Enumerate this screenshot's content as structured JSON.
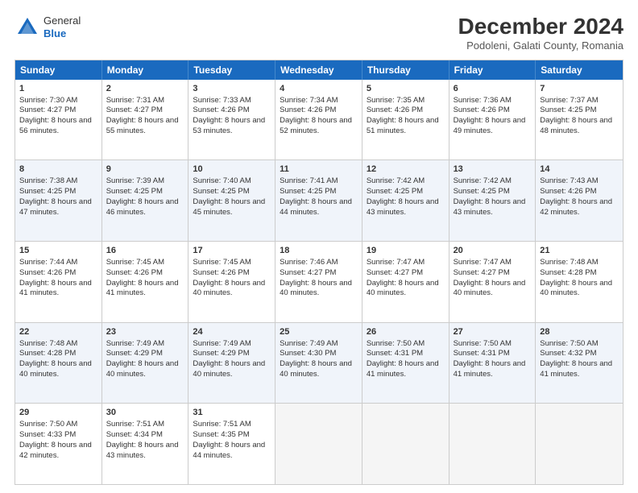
{
  "header": {
    "logo_general": "General",
    "logo_blue": "Blue",
    "title": "December 2024",
    "subtitle": "Podoleni, Galati County, Romania"
  },
  "days": [
    "Sunday",
    "Monday",
    "Tuesday",
    "Wednesday",
    "Thursday",
    "Friday",
    "Saturday"
  ],
  "weeks": [
    [
      {
        "num": "1",
        "sunrise": "Sunrise: 7:30 AM",
        "sunset": "Sunset: 4:27 PM",
        "daylight": "Daylight: 8 hours and 56 minutes."
      },
      {
        "num": "2",
        "sunrise": "Sunrise: 7:31 AM",
        "sunset": "Sunset: 4:27 PM",
        "daylight": "Daylight: 8 hours and 55 minutes."
      },
      {
        "num": "3",
        "sunrise": "Sunrise: 7:33 AM",
        "sunset": "Sunset: 4:26 PM",
        "daylight": "Daylight: 8 hours and 53 minutes."
      },
      {
        "num": "4",
        "sunrise": "Sunrise: 7:34 AM",
        "sunset": "Sunset: 4:26 PM",
        "daylight": "Daylight: 8 hours and 52 minutes."
      },
      {
        "num": "5",
        "sunrise": "Sunrise: 7:35 AM",
        "sunset": "Sunset: 4:26 PM",
        "daylight": "Daylight: 8 hours and 51 minutes."
      },
      {
        "num": "6",
        "sunrise": "Sunrise: 7:36 AM",
        "sunset": "Sunset: 4:26 PM",
        "daylight": "Daylight: 8 hours and 49 minutes."
      },
      {
        "num": "7",
        "sunrise": "Sunrise: 7:37 AM",
        "sunset": "Sunset: 4:25 PM",
        "daylight": "Daylight: 8 hours and 48 minutes."
      }
    ],
    [
      {
        "num": "8",
        "sunrise": "Sunrise: 7:38 AM",
        "sunset": "Sunset: 4:25 PM",
        "daylight": "Daylight: 8 hours and 47 minutes."
      },
      {
        "num": "9",
        "sunrise": "Sunrise: 7:39 AM",
        "sunset": "Sunset: 4:25 PM",
        "daylight": "Daylight: 8 hours and 46 minutes."
      },
      {
        "num": "10",
        "sunrise": "Sunrise: 7:40 AM",
        "sunset": "Sunset: 4:25 PM",
        "daylight": "Daylight: 8 hours and 45 minutes."
      },
      {
        "num": "11",
        "sunrise": "Sunrise: 7:41 AM",
        "sunset": "Sunset: 4:25 PM",
        "daylight": "Daylight: 8 hours and 44 minutes."
      },
      {
        "num": "12",
        "sunrise": "Sunrise: 7:42 AM",
        "sunset": "Sunset: 4:25 PM",
        "daylight": "Daylight: 8 hours and 43 minutes."
      },
      {
        "num": "13",
        "sunrise": "Sunrise: 7:42 AM",
        "sunset": "Sunset: 4:25 PM",
        "daylight": "Daylight: 8 hours and 43 minutes."
      },
      {
        "num": "14",
        "sunrise": "Sunrise: 7:43 AM",
        "sunset": "Sunset: 4:26 PM",
        "daylight": "Daylight: 8 hours and 42 minutes."
      }
    ],
    [
      {
        "num": "15",
        "sunrise": "Sunrise: 7:44 AM",
        "sunset": "Sunset: 4:26 PM",
        "daylight": "Daylight: 8 hours and 41 minutes."
      },
      {
        "num": "16",
        "sunrise": "Sunrise: 7:45 AM",
        "sunset": "Sunset: 4:26 PM",
        "daylight": "Daylight: 8 hours and 41 minutes."
      },
      {
        "num": "17",
        "sunrise": "Sunrise: 7:45 AM",
        "sunset": "Sunset: 4:26 PM",
        "daylight": "Daylight: 8 hours and 40 minutes."
      },
      {
        "num": "18",
        "sunrise": "Sunrise: 7:46 AM",
        "sunset": "Sunset: 4:27 PM",
        "daylight": "Daylight: 8 hours and 40 minutes."
      },
      {
        "num": "19",
        "sunrise": "Sunrise: 7:47 AM",
        "sunset": "Sunset: 4:27 PM",
        "daylight": "Daylight: 8 hours and 40 minutes."
      },
      {
        "num": "20",
        "sunrise": "Sunrise: 7:47 AM",
        "sunset": "Sunset: 4:27 PM",
        "daylight": "Daylight: 8 hours and 40 minutes."
      },
      {
        "num": "21",
        "sunrise": "Sunrise: 7:48 AM",
        "sunset": "Sunset: 4:28 PM",
        "daylight": "Daylight: 8 hours and 40 minutes."
      }
    ],
    [
      {
        "num": "22",
        "sunrise": "Sunrise: 7:48 AM",
        "sunset": "Sunset: 4:28 PM",
        "daylight": "Daylight: 8 hours and 40 minutes."
      },
      {
        "num": "23",
        "sunrise": "Sunrise: 7:49 AM",
        "sunset": "Sunset: 4:29 PM",
        "daylight": "Daylight: 8 hours and 40 minutes."
      },
      {
        "num": "24",
        "sunrise": "Sunrise: 7:49 AM",
        "sunset": "Sunset: 4:29 PM",
        "daylight": "Daylight: 8 hours and 40 minutes."
      },
      {
        "num": "25",
        "sunrise": "Sunrise: 7:49 AM",
        "sunset": "Sunset: 4:30 PM",
        "daylight": "Daylight: 8 hours and 40 minutes."
      },
      {
        "num": "26",
        "sunrise": "Sunrise: 7:50 AM",
        "sunset": "Sunset: 4:31 PM",
        "daylight": "Daylight: 8 hours and 41 minutes."
      },
      {
        "num": "27",
        "sunrise": "Sunrise: 7:50 AM",
        "sunset": "Sunset: 4:31 PM",
        "daylight": "Daylight: 8 hours and 41 minutes."
      },
      {
        "num": "28",
        "sunrise": "Sunrise: 7:50 AM",
        "sunset": "Sunset: 4:32 PM",
        "daylight": "Daylight: 8 hours and 41 minutes."
      }
    ],
    [
      {
        "num": "29",
        "sunrise": "Sunrise: 7:50 AM",
        "sunset": "Sunset: 4:33 PM",
        "daylight": "Daylight: 8 hours and 42 minutes."
      },
      {
        "num": "30",
        "sunrise": "Sunrise: 7:51 AM",
        "sunset": "Sunset: 4:34 PM",
        "daylight": "Daylight: 8 hours and 43 minutes."
      },
      {
        "num": "31",
        "sunrise": "Sunrise: 7:51 AM",
        "sunset": "Sunset: 4:35 PM",
        "daylight": "Daylight: 8 hours and 44 minutes."
      },
      null,
      null,
      null,
      null
    ]
  ]
}
